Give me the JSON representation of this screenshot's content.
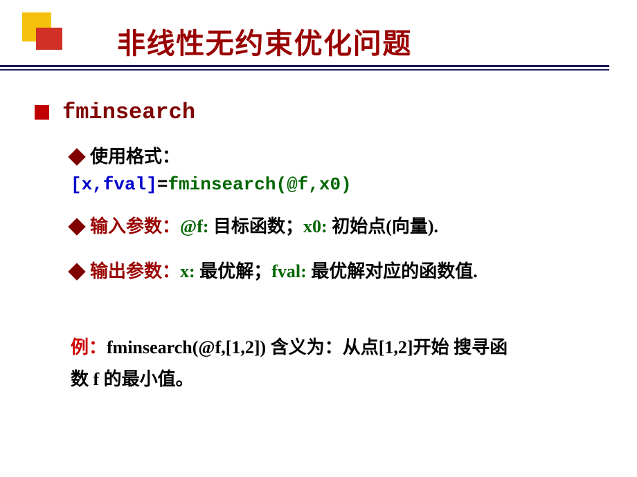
{
  "header": {
    "title": "非线性无约束优化问题"
  },
  "main": {
    "function_name": "fminsearch",
    "usage_label": "使用格式：",
    "code": {
      "left": "[x,fval]",
      "equals": "=",
      "func": "fminsearch(@f,x0)"
    },
    "input": {
      "label": "输入参数：",
      "p1": "@f:",
      "d1": " 目标函数；",
      "p2": "x0:",
      "d2": " 初始点(向量)."
    },
    "output": {
      "label": "输出参数：",
      "p1": "x:",
      "d1": " 最优解；",
      "p2": "fval:",
      "d2": " 最优解对应的函数值."
    },
    "example": {
      "label": "例：",
      "code": "fminsearch(@f,[1,2]) ",
      "meaning_label": "含义为：",
      "meaning1": "从点[1,2]开始 搜寻函",
      "meaning2": "数 f 的最小值。"
    }
  }
}
